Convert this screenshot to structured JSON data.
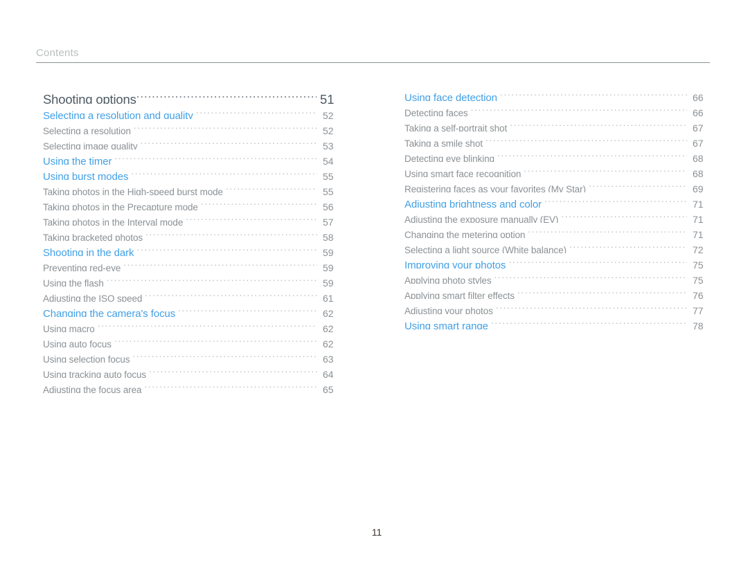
{
  "header": {
    "title": "Contents"
  },
  "footer": {
    "page_number": "11"
  },
  "colors": {
    "section_blue": "#41a0e6",
    "sub_gray": "#8b9094",
    "top_heading": "#4d5a63",
    "header_gray": "#b9bfbd",
    "rule": "#8a8f92",
    "folio": "#3a3230"
  },
  "columns": {
    "left": [
      {
        "level": "top",
        "label": "Shooting options",
        "page": "51"
      },
      {
        "level": "section",
        "label": "Selecting a resolution and quality",
        "page": "52"
      },
      {
        "level": "sub",
        "label": "Selecting a resolution",
        "page": "52"
      },
      {
        "level": "sub",
        "label": "Selecting image quality",
        "page": "53"
      },
      {
        "level": "section",
        "label": "Using the timer",
        "page": "54"
      },
      {
        "level": "section",
        "label": "Using burst modes",
        "page": "55"
      },
      {
        "level": "sub",
        "label": "Taking photos in the High-speed burst mode",
        "page": "55"
      },
      {
        "level": "sub",
        "label": "Taking photos in the Precapture mode",
        "page": "56"
      },
      {
        "level": "sub",
        "label": "Taking photos in the Interval mode",
        "page": "57"
      },
      {
        "level": "sub",
        "label": "Taking bracketed photos",
        "page": "58"
      },
      {
        "level": "section",
        "label": "Shooting in the dark",
        "page": "59"
      },
      {
        "level": "sub",
        "label": "Preventing red-eye",
        "page": "59"
      },
      {
        "level": "sub",
        "label": "Using the flash",
        "page": "59"
      },
      {
        "level": "sub",
        "label": "Adjusting the ISO speed",
        "page": "61"
      },
      {
        "level": "section",
        "label": "Changing the camera's focus",
        "page": "62"
      },
      {
        "level": "sub",
        "label": "Using macro",
        "page": "62"
      },
      {
        "level": "sub",
        "label": "Using auto focus",
        "page": "62"
      },
      {
        "level": "sub",
        "label": "Using selection focus",
        "page": "63"
      },
      {
        "level": "sub",
        "label": "Using tracking auto focus",
        "page": "64"
      },
      {
        "level": "sub",
        "label": "Adjusting the focus area",
        "page": "65"
      }
    ],
    "right": [
      {
        "level": "section",
        "label": "Using face detection",
        "page": "66"
      },
      {
        "level": "sub",
        "label": "Detecting faces",
        "page": "66"
      },
      {
        "level": "sub",
        "label": "Taking a self-portrait shot",
        "page": "67"
      },
      {
        "level": "sub",
        "label": "Taking a smile shot",
        "page": "67"
      },
      {
        "level": "sub",
        "label": "Detecting eye blinking",
        "page": "68"
      },
      {
        "level": "sub",
        "label": "Using smart face recognition",
        "page": "68"
      },
      {
        "level": "sub",
        "label": "Registering faces as your favorites (My Star)",
        "page": "69"
      },
      {
        "level": "section",
        "label": "Adjusting brightness and color",
        "page": "71"
      },
      {
        "level": "sub",
        "label": "Adjusting the exposure manually (EV)",
        "page": "71"
      },
      {
        "level": "sub",
        "label": "Changing the metering option",
        "page": "71"
      },
      {
        "level": "sub",
        "label": "Selecting a light source (White balance)",
        "page": "72"
      },
      {
        "level": "section",
        "label": "Improving your photos",
        "page": "75"
      },
      {
        "level": "sub",
        "label": "Applying photo styles",
        "page": "75"
      },
      {
        "level": "sub",
        "label": "Applying smart filter effects",
        "page": "76"
      },
      {
        "level": "sub",
        "label": "Adjusting your photos",
        "page": "77"
      },
      {
        "level": "section",
        "label": "Using smart range",
        "page": "78"
      }
    ]
  }
}
